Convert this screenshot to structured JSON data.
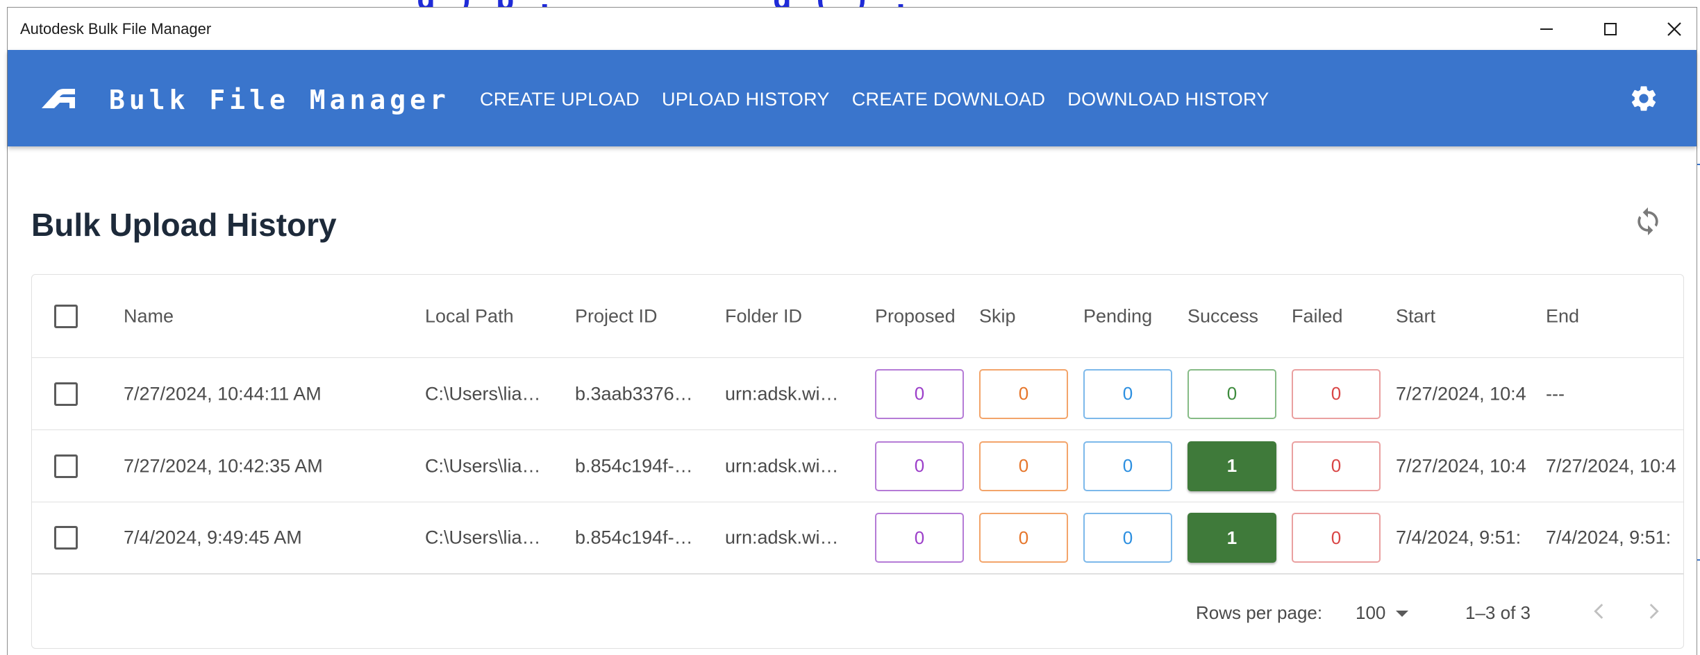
{
  "window": {
    "title": "Autodesk Bulk File Manager"
  },
  "appbar": {
    "brand": "Bulk File Manager",
    "nav": [
      "CREATE UPLOAD",
      "UPLOAD HISTORY",
      "CREATE DOWNLOAD",
      "DOWNLOAD HISTORY"
    ],
    "settings_icon": "gear-icon",
    "color": "#3a75cc"
  },
  "page": {
    "title": "Bulk Upload History",
    "refresh_icon": "refresh-icon"
  },
  "table": {
    "columns": [
      "Name",
      "Local Path",
      "Project ID",
      "Folder ID",
      "Proposed",
      "Skip",
      "Pending",
      "Success",
      "Failed",
      "Start",
      "End"
    ],
    "rows": [
      {
        "name": "7/27/2024, 10:44:11 AM",
        "local_path": "C:\\Users\\lia…",
        "project_id": "b.3aab3376…",
        "folder_id": "urn:adsk.wi…",
        "proposed": "0",
        "skip": "0",
        "pending": "0",
        "success": "0",
        "failed": "0",
        "start": "7/27/2024, 10:4",
        "end": "---"
      },
      {
        "name": "7/27/2024, 10:42:35 AM",
        "local_path": "C:\\Users\\lia…",
        "project_id": "b.854c194f-…",
        "folder_id": "urn:adsk.wi…",
        "proposed": "0",
        "skip": "0",
        "pending": "0",
        "success": "1",
        "failed": "0",
        "start": "7/27/2024, 10:4",
        "end": "7/27/2024, 10:4"
      },
      {
        "name": "7/4/2024, 9:49:45 AM",
        "local_path": "C:\\Users\\lia…",
        "project_id": "b.854c194f-…",
        "folder_id": "urn:adsk.wi…",
        "proposed": "0",
        "skip": "0",
        "pending": "0",
        "success": "1",
        "failed": "0",
        "start": "7/4/2024, 9:51:",
        "end": "7/4/2024, 9:51:"
      }
    ],
    "status_colors": {
      "proposed": "#9c3fc9",
      "skip": "#e6762b",
      "pending": "#2c8fe0",
      "success": "#3f7a3a",
      "failed": "#d94545"
    }
  },
  "pagination": {
    "rows_per_page_label": "Rows per page:",
    "rows_per_page_value": "100",
    "range": "1–3 of 3"
  }
}
